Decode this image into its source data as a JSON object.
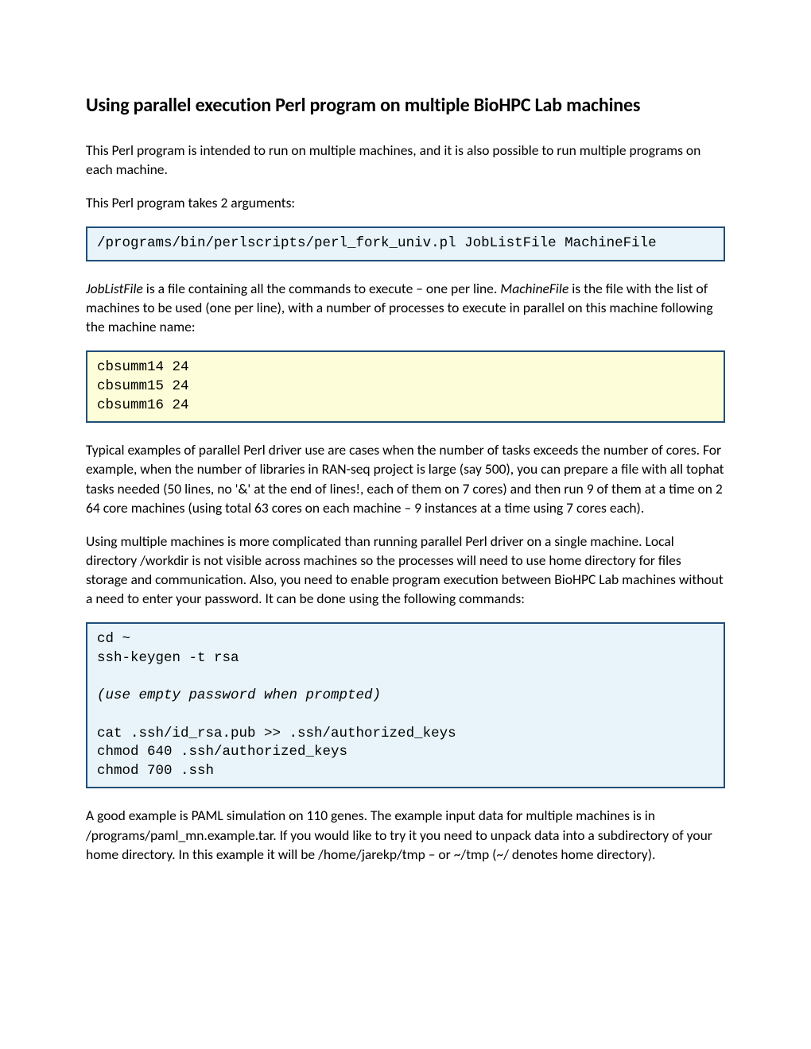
{
  "title": "Using parallel execution Perl program on multiple BioHPC Lab machines",
  "p1": "This Perl program is intended to run on multiple machines, and it is also possible to run multiple programs on each machine.",
  "p2": "This Perl program takes 2 arguments:",
  "code1": "/programs/bin/perlscripts/perl_fork_univ.pl JobListFile MachineFile",
  "p3a": "JobListFile",
  "p3b": " is a file containing all the commands to execute – one per line. ",
  "p3c": "MachineFile",
  "p3d": " is the file with the list of machines to be used (one per line), with a number of processes to execute in parallel on this machine following the machine name:",
  "code2": "cbsumm14 24\ncbsumm15 24\ncbsumm16 24",
  "p4": "Typical examples of parallel Perl driver use are cases when the number of tasks exceeds the number of cores. For example, when the number of libraries in RAN-seq project is large (say 500), you can prepare a file with all tophat tasks needed (50 lines, no '&' at the end of lines!, each of them on 7 cores) and then run 9 of them at a time on 2 64 core machines (using total 63 cores on each machine – 9 instances at a time using 7 cores each).",
  "p5": "Using multiple machines is more complicated than running parallel Perl driver on a single machine. Local directory /workdir is not visible across machines so the processes will need to use home directory for files storage and communication. Also, you need to enable program execution between BioHPC Lab machines without a need to enter your password. It can be done using the following commands:",
  "code3a": "cd ~\nssh-keygen -t rsa\n\n",
  "code3b": "(use empty password when prompted)",
  "code3c": "\n\ncat .ssh/id_rsa.pub >> .ssh/authorized_keys\nchmod 640 .ssh/authorized_keys\nchmod 700 .ssh",
  "p6": "A good example is PAML simulation on 110 genes. The example input data for multiple machines is in /programs/paml_mn.example.tar. If you would like to try it you need to unpack data into a subdirectory of your home directory. In this example it will be /home/jarekp/tmp – or ~/tmp (~/ denotes home directory)."
}
